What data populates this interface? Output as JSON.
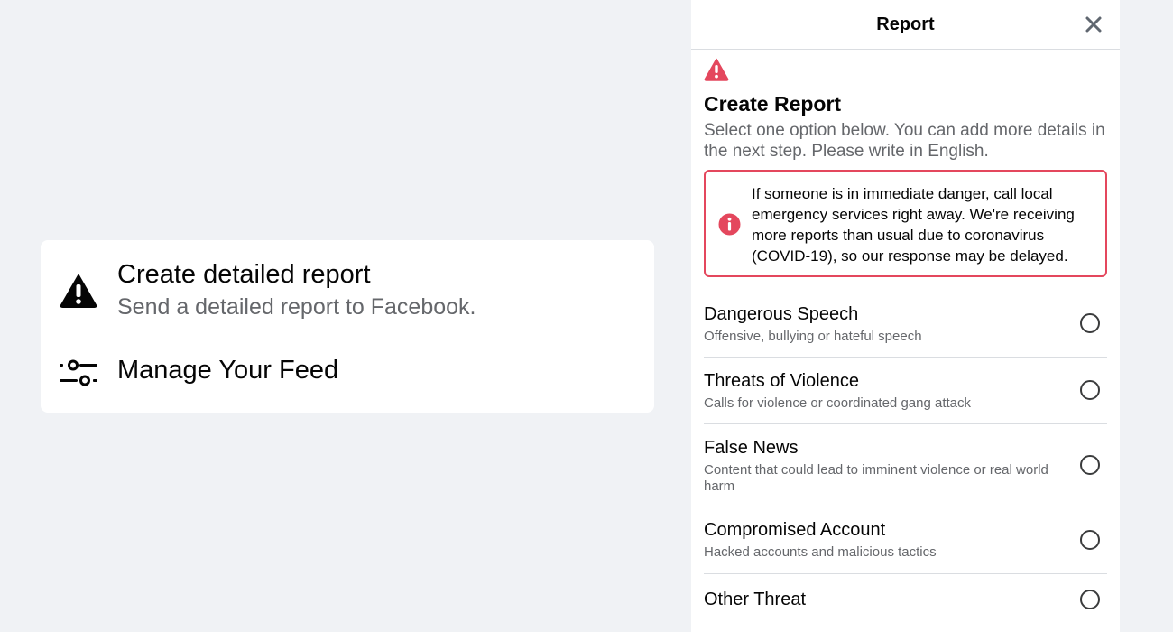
{
  "menu": {
    "report": {
      "title": "Create detailed report",
      "subtitle": "Send a detailed report to Facebook.",
      "icon": "warning-triangle-icon"
    },
    "feed": {
      "title": "Manage Your Feed",
      "icon": "sliders-icon"
    }
  },
  "panel": {
    "header_title": "Report",
    "close_icon": "close-icon",
    "create_title": "Create Report",
    "create_desc": "Select one option below. You can add more details in the next step. Please write in English.",
    "notice": "If someone is in immediate danger, call local emergency services right away. We're receiving more reports than usual due to coronavirus (COVID-19), so our response may be delayed.",
    "accent_color": "#e4475d",
    "options": [
      {
        "label": "Dangerous Speech",
        "desc": "Offensive, bullying or hateful speech"
      },
      {
        "label": "Threats of Violence",
        "desc": "Calls for violence or coordinated gang attack"
      },
      {
        "label": "False News",
        "desc": "Content that could lead to imminent violence or real world harm"
      },
      {
        "label": "Compromised Account",
        "desc": "Hacked accounts and malicious tactics"
      },
      {
        "label": "Other Threat",
        "desc": ""
      }
    ]
  }
}
